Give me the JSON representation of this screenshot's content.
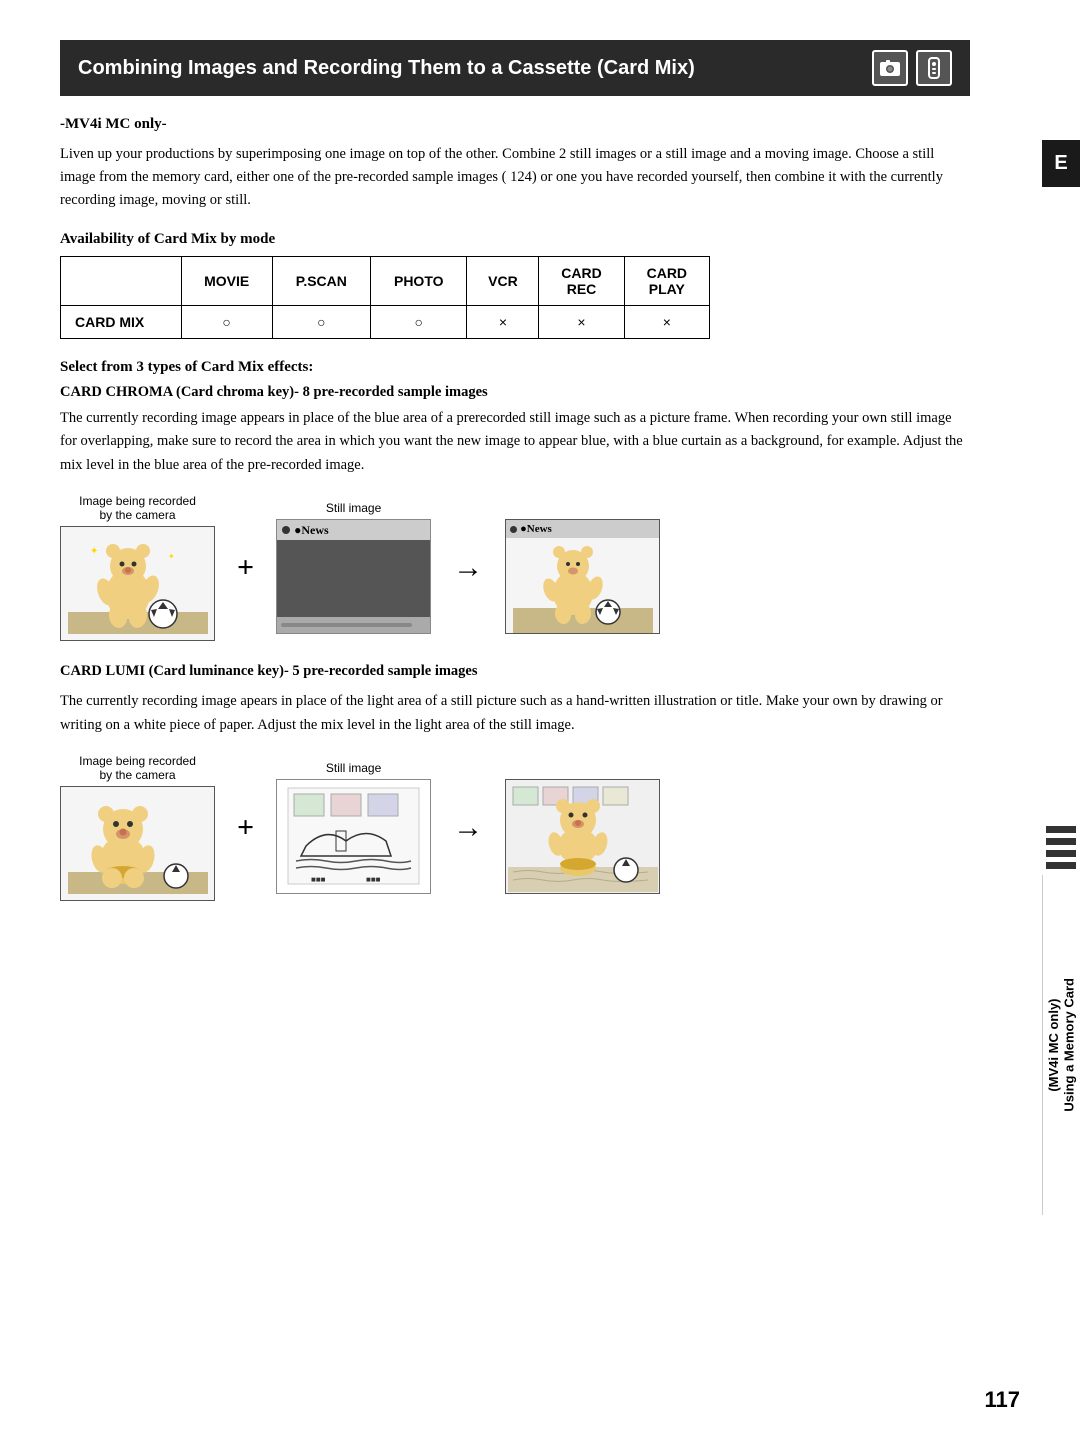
{
  "header": {
    "title": "Combining Images and Recording Them to a Cassette (Card Mix)",
    "icon1": "📷",
    "icon2": "📡"
  },
  "mv_label": "-MV4i MC only-",
  "intro": {
    "text": "Liven up your productions by superimposing one image on top of the other. Combine 2 still images or a still image and a moving image. Choose a still image from the memory card, either one of the pre-recorded sample images ( 124) or one you have recorded yourself, then combine it with the currently recording image, moving or still."
  },
  "availability": {
    "heading": "Availability of Card Mix by mode",
    "columns": [
      "MOVIE",
      "P.SCAN",
      "PHOTO",
      "VCR",
      "CARD REC",
      "CARD PLAY"
    ],
    "rows": [
      {
        "label": "CARD MIX",
        "values": [
          "○",
          "○",
          "○",
          "×",
          "×",
          "×"
        ]
      }
    ]
  },
  "select_heading": "Select from 3 types of Card Mix effects:",
  "card_chroma": {
    "heading": "CARD CHROMA (Card chroma key)",
    "suffix": "- 8 pre-recorded sample images",
    "body1": "The currently recording image appears in place of the blue area of a prerecorded still image such as a picture frame. When recording your own still image for overlapping, make sure to record the area in which you want the new image to appear blue, with a blue curtain as a background, for example. Adjust the mix level in the blue area of the pre-recorded image."
  },
  "diagram1": {
    "label_left": "Image being recorded\nby the camera",
    "label_middle": "Still image",
    "label_left_empty": ""
  },
  "card_lumi": {
    "heading": "CARD LUMI (Card luminance key)",
    "suffix": "- 5 pre-recorded sample images",
    "body": "The currently recording image apears in place of the light area of a still picture such as a hand-written illustration or title. Make your own by drawing or writing on a white piece of paper. Adjust the mix level in the light area of the still image."
  },
  "diagram2": {
    "label_left": "Image being recorded\nby the camera",
    "label_middle": "Still image"
  },
  "right_tab": {
    "letter": "E"
  },
  "sidebar_text": "Using a Memory Card\n(MV4i MC only)",
  "page_number": "117"
}
